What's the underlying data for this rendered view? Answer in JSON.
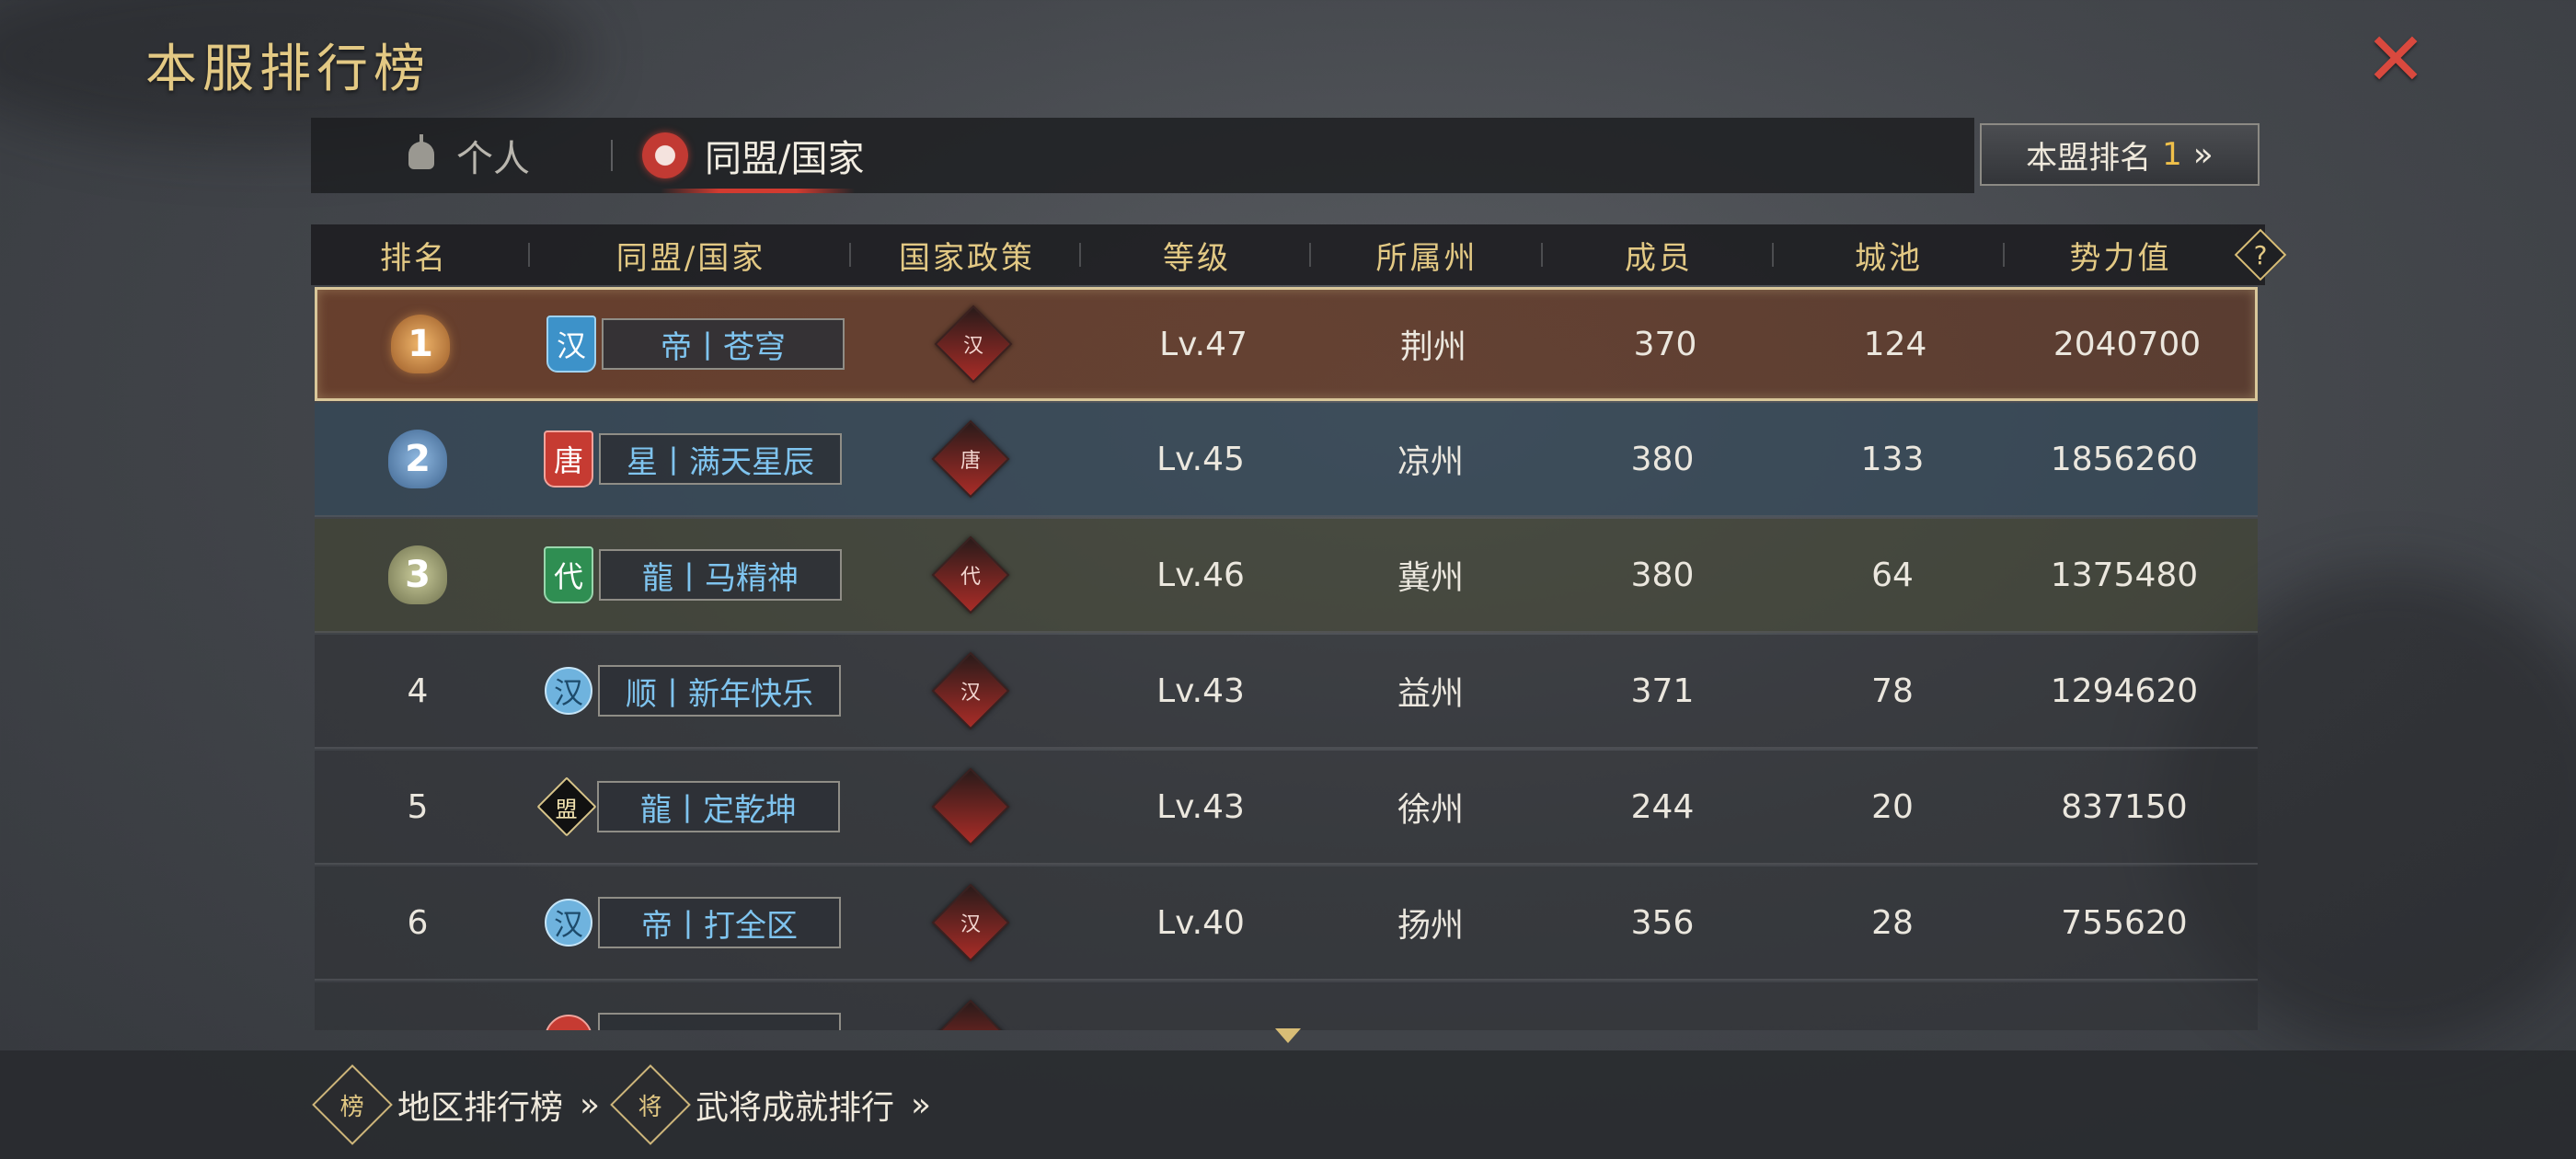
{
  "title": "本服排行榜",
  "tabs": [
    {
      "label": "个人",
      "active": false
    },
    {
      "label": "同盟/国家",
      "active": true
    }
  ],
  "alliance_rank_button": {
    "label": "本盟排名",
    "value": "1",
    "chevron": "»"
  },
  "help_label": "?",
  "columns": [
    "排名",
    "同盟/国家",
    "国家政策",
    "等级",
    "所属州",
    "成员",
    "城池",
    "势力值"
  ],
  "rows": [
    {
      "rank": "1",
      "flag": "汉",
      "name": "帝丨苍穹",
      "policy": "汉",
      "level": "Lv.47",
      "province": "荆州",
      "members": "370",
      "cities": "124",
      "power": "2040700"
    },
    {
      "rank": "2",
      "flag": "唐",
      "name": "星丨满天星辰",
      "policy": "唐",
      "level": "Lv.45",
      "province": "凉州",
      "members": "380",
      "cities": "133",
      "power": "1856260"
    },
    {
      "rank": "3",
      "flag": "代",
      "name": "龍丨马精神",
      "policy": "代",
      "level": "Lv.46",
      "province": "冀州",
      "members": "380",
      "cities": "64",
      "power": "1375480"
    },
    {
      "rank": "4",
      "flag": "汉",
      "name": "顺丨新年快乐",
      "policy": "汉",
      "level": "Lv.43",
      "province": "益州",
      "members": "371",
      "cities": "78",
      "power": "1294620"
    },
    {
      "rank": "5",
      "flag": "盟",
      "name": "龍丨定乾坤",
      "policy": "",
      "level": "Lv.43",
      "province": "徐州",
      "members": "244",
      "cities": "20",
      "power": "837150"
    },
    {
      "rank": "6",
      "flag": "汉",
      "name": "帝丨打全区",
      "policy": "汉",
      "level": "Lv.40",
      "province": "扬州",
      "members": "356",
      "cities": "28",
      "power": "755620"
    }
  ],
  "footer": {
    "regional_ranking": {
      "label": "地区排行榜",
      "chevron": "»",
      "icon_text": "榜"
    },
    "general_ranking": {
      "label": "武将成就排行",
      "chevron": "»",
      "icon_text": "将"
    }
  },
  "icons": {
    "close": "close-icon",
    "personal_tab": "helmet-icon",
    "alliance_tab": "alliance-emblem-icon",
    "help": "help-icon",
    "scroll": "scroll-down-icon"
  },
  "colors": {
    "gold_text": "#e3c984",
    "alliance_name": "#7fc4ef",
    "close": "#d9493e",
    "rank_one_bg": "#6e3e28",
    "rank_two_bg": "#344858",
    "rank_three_bg": "#424434",
    "active_tab_underline": "#d23b30"
  }
}
